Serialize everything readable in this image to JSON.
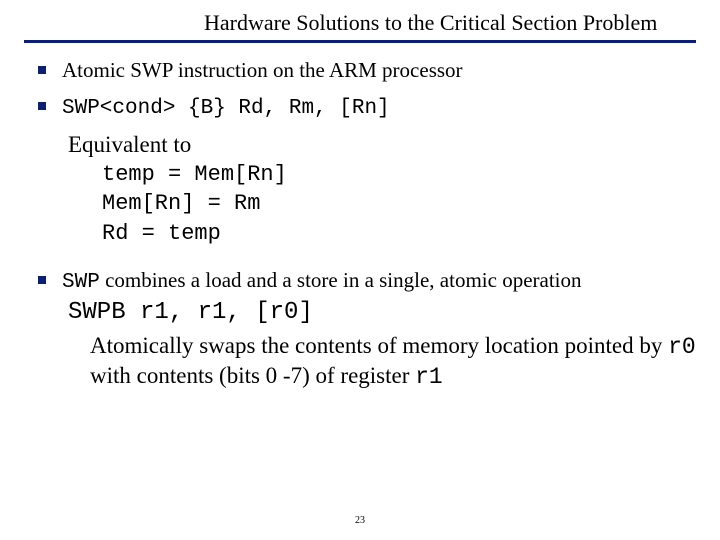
{
  "title": "Hardware Solutions to the Critical Section Problem",
  "bullets": {
    "b1": "Atomic SWP instruction on the ARM processor",
    "b2_code": "SWP<cond> {B} Rd, Rm, [Rn]",
    "b2_equiv_label": "Equivalent to",
    "b2_eq_line1": "temp = Mem[Rn]",
    "b2_eq_line2": "Mem[Rn] = Rm",
    "b2_eq_line3": "Rd = temp",
    "b3_prefix_code": "SWP",
    "b3_text": " combines a load and a store in a single, atomic operation",
    "b3_example": "SWPB   r1, r1, [r0]",
    "b3_explain_pre": "Atomically swaps the contents of memory location pointed by ",
    "b3_r0": "r0",
    "b3_explain_mid": " with contents (bits 0 -7) of register ",
    "b3_r1": "r1"
  },
  "page_number": "23"
}
